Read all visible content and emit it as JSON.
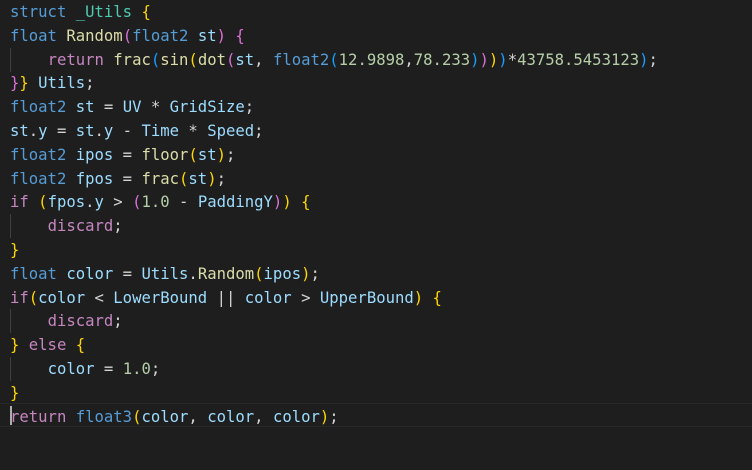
{
  "colors": {
    "background": "#1e1e1e",
    "text": "#d4d4d4",
    "keyword_blue": "#569cd6",
    "control_purple": "#c586c0",
    "function_yellow": "#dcdcaa",
    "variable_blue": "#9cdcfe",
    "type_teal": "#4ec9b0",
    "number_green": "#b5cea8",
    "bracket_gold": "#ffd700",
    "bracket_orchid": "#da70d6",
    "bracket_blue": "#179fff"
  },
  "lines": [
    [
      {
        "t": "struct",
        "c": "kw"
      },
      {
        "t": " "
      },
      {
        "t": "_Utils",
        "c": "type"
      },
      {
        "t": " "
      },
      {
        "t": "{",
        "c": "b1"
      }
    ],
    [
      {
        "t": "float",
        "c": "kw"
      },
      {
        "t": " "
      },
      {
        "t": "Random",
        "c": "fn"
      },
      {
        "t": "(",
        "c": "b2"
      },
      {
        "t": "float2",
        "c": "kw"
      },
      {
        "t": " "
      },
      {
        "t": "st",
        "c": "var"
      },
      {
        "t": ")",
        "c": "b2"
      },
      {
        "t": " "
      },
      {
        "t": "{",
        "c": "b2"
      }
    ],
    [
      {
        "t": "    "
      },
      {
        "t": "return",
        "c": "ctl"
      },
      {
        "t": " "
      },
      {
        "t": "frac",
        "c": "fn"
      },
      {
        "t": "(",
        "c": "b3"
      },
      {
        "t": "sin",
        "c": "fn"
      },
      {
        "t": "(",
        "c": "b1"
      },
      {
        "t": "dot",
        "c": "fn"
      },
      {
        "t": "(",
        "c": "b2"
      },
      {
        "t": "st",
        "c": "var"
      },
      {
        "t": ", "
      },
      {
        "t": "float2",
        "c": "kw"
      },
      {
        "t": "(",
        "c": "b3"
      },
      {
        "t": "12.9898",
        "c": "num"
      },
      {
        "t": ","
      },
      {
        "t": "78.233",
        "c": "num"
      },
      {
        "t": ")",
        "c": "b3"
      },
      {
        "t": ")",
        "c": "b2"
      },
      {
        "t": ")",
        "c": "b1"
      },
      {
        "t": ")",
        "c": "b3"
      },
      {
        "t": "*"
      },
      {
        "t": "43758.5453123",
        "c": "num"
      },
      {
        "t": ")",
        "c": "b3"
      },
      {
        "t": ";"
      }
    ],
    [
      {
        "t": "}",
        "c": "b2"
      },
      {
        "t": "}",
        "c": "b1"
      },
      {
        "t": " "
      },
      {
        "t": "Utils",
        "c": "var"
      },
      {
        "t": ";"
      }
    ],
    [
      {
        "t": "float2",
        "c": "kw"
      },
      {
        "t": " "
      },
      {
        "t": "st",
        "c": "var"
      },
      {
        "t": " = "
      },
      {
        "t": "UV",
        "c": "var"
      },
      {
        "t": " * "
      },
      {
        "t": "GridSize",
        "c": "var"
      },
      {
        "t": ";"
      }
    ],
    [
      {
        "t": "st",
        "c": "var"
      },
      {
        "t": "."
      },
      {
        "t": "y",
        "c": "var"
      },
      {
        "t": " = "
      },
      {
        "t": "st",
        "c": "var"
      },
      {
        "t": "."
      },
      {
        "t": "y",
        "c": "var"
      },
      {
        "t": " - "
      },
      {
        "t": "Time",
        "c": "var"
      },
      {
        "t": " * "
      },
      {
        "t": "Speed",
        "c": "var"
      },
      {
        "t": ";"
      }
    ],
    [
      {
        "t": "float2",
        "c": "kw"
      },
      {
        "t": " "
      },
      {
        "t": "ipos",
        "c": "var"
      },
      {
        "t": " = "
      },
      {
        "t": "floor",
        "c": "fn"
      },
      {
        "t": "(",
        "c": "b1"
      },
      {
        "t": "st",
        "c": "var"
      },
      {
        "t": ")",
        "c": "b1"
      },
      {
        "t": ";"
      }
    ],
    [
      {
        "t": "float2",
        "c": "kw"
      },
      {
        "t": " "
      },
      {
        "t": "fpos",
        "c": "var"
      },
      {
        "t": " = "
      },
      {
        "t": "frac",
        "c": "fn"
      },
      {
        "t": "(",
        "c": "b1"
      },
      {
        "t": "st",
        "c": "var"
      },
      {
        "t": ")",
        "c": "b1"
      },
      {
        "t": ";"
      }
    ],
    [
      {
        "t": "if",
        "c": "ctl"
      },
      {
        "t": " "
      },
      {
        "t": "(",
        "c": "b1"
      },
      {
        "t": "fpos",
        "c": "var"
      },
      {
        "t": "."
      },
      {
        "t": "y",
        "c": "var"
      },
      {
        "t": " > "
      },
      {
        "t": "(",
        "c": "b2"
      },
      {
        "t": "1.0",
        "c": "num"
      },
      {
        "t": " - "
      },
      {
        "t": "PaddingY",
        "c": "var"
      },
      {
        "t": ")",
        "c": "b2"
      },
      {
        "t": ")",
        "c": "b1"
      },
      {
        "t": " "
      },
      {
        "t": "{",
        "c": "b1"
      }
    ],
    [
      {
        "t": "    "
      },
      {
        "t": "discard",
        "c": "ctl"
      },
      {
        "t": ";"
      }
    ],
    [
      {
        "t": "}",
        "c": "b1"
      }
    ],
    [
      {
        "t": "float",
        "c": "kw"
      },
      {
        "t": " "
      },
      {
        "t": "color",
        "c": "var"
      },
      {
        "t": " = "
      },
      {
        "t": "Utils",
        "c": "var"
      },
      {
        "t": "."
      },
      {
        "t": "Random",
        "c": "fn"
      },
      {
        "t": "(",
        "c": "b1"
      },
      {
        "t": "ipos",
        "c": "var"
      },
      {
        "t": ")",
        "c": "b1"
      },
      {
        "t": ";"
      }
    ],
    [
      {
        "t": "if",
        "c": "ctl"
      },
      {
        "t": "(",
        "c": "b1"
      },
      {
        "t": "color",
        "c": "var"
      },
      {
        "t": " < "
      },
      {
        "t": "LowerBound",
        "c": "var"
      },
      {
        "t": " || "
      },
      {
        "t": "color",
        "c": "var"
      },
      {
        "t": " > "
      },
      {
        "t": "UpperBound",
        "c": "var"
      },
      {
        "t": ")",
        "c": "b1"
      },
      {
        "t": " "
      },
      {
        "t": "{",
        "c": "b1"
      }
    ],
    [
      {
        "t": "    "
      },
      {
        "t": "discard",
        "c": "ctl"
      },
      {
        "t": ";"
      }
    ],
    [
      {
        "t": "}",
        "c": "b1"
      },
      {
        "t": " "
      },
      {
        "t": "else",
        "c": "ctl"
      },
      {
        "t": " "
      },
      {
        "t": "{",
        "c": "b1"
      }
    ],
    [
      {
        "t": "    "
      },
      {
        "t": "color",
        "c": "var"
      },
      {
        "t": " = "
      },
      {
        "t": "1.0",
        "c": "num"
      },
      {
        "t": ";"
      }
    ],
    [
      {
        "t": "}",
        "c": "b1"
      }
    ],
    [
      {
        "t": "return",
        "c": "ctl"
      },
      {
        "t": " "
      },
      {
        "t": "float3",
        "c": "kw"
      },
      {
        "t": "(",
        "c": "b1"
      },
      {
        "t": "color",
        "c": "var"
      },
      {
        "t": ", "
      },
      {
        "t": "color",
        "c": "var"
      },
      {
        "t": ", "
      },
      {
        "t": "color",
        "c": "var"
      },
      {
        "t": ")",
        "c": "b1"
      },
      {
        "t": ";"
      }
    ]
  ]
}
